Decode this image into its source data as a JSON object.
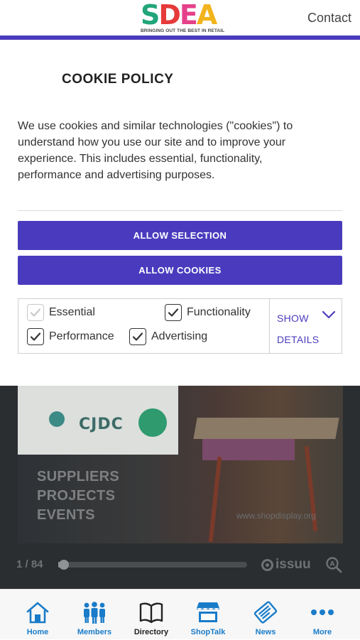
{
  "header": {
    "logo_letters": [
      "S",
      "D",
      "E",
      "A"
    ],
    "logo_colors": [
      "#21a57a",
      "#e63a3a",
      "#e5418a",
      "#f2b41c"
    ],
    "logo_tagline": "BRINGING OUT THE BEST IN RETAIL",
    "contact_label": "Contact",
    "accent_color": "#4a3bbe"
  },
  "cookie": {
    "title": "COOKIE POLICY",
    "body": "We use cookies and similar technologies (\"cookies\") to understand how you use our site and to improve your experience. This includes essential, functionality, performance and advertising purposes.",
    "allow_selection_label": "ALLOW SELECTION",
    "allow_cookies_label": "ALLOW COOKIES",
    "options": [
      {
        "label": "Essential",
        "checked": true,
        "disabled": true
      },
      {
        "label": "Functionality",
        "checked": true,
        "disabled": false
      },
      {
        "label": "Performance",
        "checked": true,
        "disabled": false
      },
      {
        "label": "Advertising",
        "checked": true,
        "disabled": false
      }
    ],
    "show_label": "SHOW",
    "details_label": "DETAILS"
  },
  "embed": {
    "logo_text": "CJDC",
    "words": [
      "SUPPLIERS",
      "PROJECTS",
      "EVENTS"
    ],
    "url": "www.shopdisplay.org",
    "page_count": "1 / 84",
    "progress": 0.012,
    "issuu_label": "issuu"
  },
  "tabbar": {
    "tabs": [
      {
        "label": "Home",
        "icon": "home-icon"
      },
      {
        "label": "Members",
        "icon": "members-icon"
      },
      {
        "label": "Directory",
        "icon": "book-icon"
      },
      {
        "label": "ShopTalk",
        "icon": "shop-icon"
      },
      {
        "label": "News",
        "icon": "news-icon"
      },
      {
        "label": "More",
        "icon": "more-icon"
      }
    ],
    "active_tab": "Directory",
    "tab_color": "#1a7cc9"
  }
}
